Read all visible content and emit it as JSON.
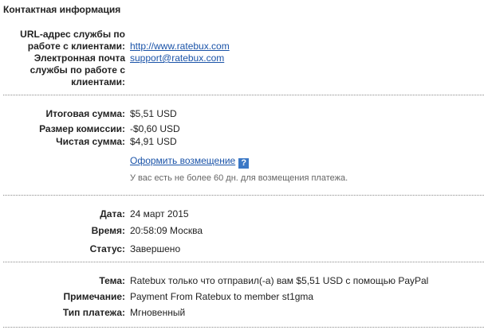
{
  "section_title": "Контактная информация",
  "contact": {
    "url_label_lines": [
      "URL-адрес службы по",
      "работе с клиентами:"
    ],
    "url_value": "http://www.ratebux.com",
    "email_label_lines": [
      "Электронная почта",
      "службы по работе с",
      "клиентами:"
    ],
    "email_value": "support@ratebux.com"
  },
  "amounts": {
    "total_label": "Итоговая сумма:",
    "total_value": "$5,51 USD",
    "fee_label": "Размер комиссии:",
    "fee_value": "-$0,60 USD",
    "net_label": "Чистая сумма:",
    "net_value": "$4,91 USD",
    "refund_link": "Оформить возмещение",
    "help_icon_glyph": "?",
    "refund_note": "У вас есть не более 60 дн. для возмещения платежа."
  },
  "details": {
    "date_label": "Дата:",
    "date_value": "24 март 2015",
    "time_label": "Время:",
    "time_value": "20:58:09 Москва",
    "status_label": "Статус:",
    "status_value": "Завершено"
  },
  "message": {
    "subject_label": "Тема:",
    "subject_value": "Ratebux только что отправил(-а) вам $5,51 USD с помощью PayPal",
    "note_label": "Примечание:",
    "note_value": "Payment From Ratebux to member st1gma",
    "type_label": "Тип платежа:",
    "type_value": "Мгновенный"
  },
  "colors": {
    "link": "#1a53a8",
    "help_badge": "#3b78c6",
    "divider": "#8a8a8a"
  }
}
